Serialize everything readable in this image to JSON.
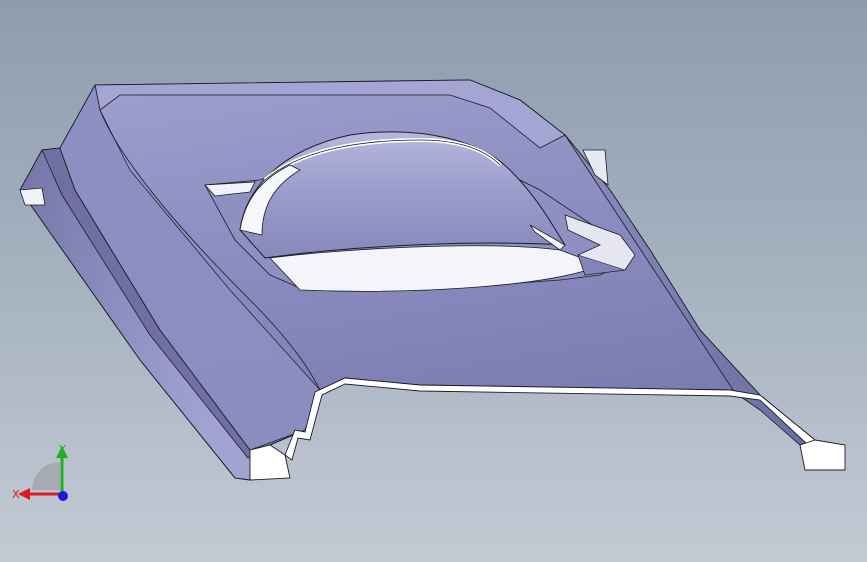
{
  "viewport": {
    "background_top": "#8e9cae",
    "background_bottom": "#c3cad4"
  },
  "model": {
    "face_color": "#8a8bc0",
    "edge_color": "#1d1d2a",
    "highlight_color": "#ffffff"
  },
  "triad": {
    "x_label": "X",
    "y_label": "Y",
    "x_color": "#e0191b",
    "y_color": "#1db21d",
    "z_color": "#1a1adb"
  }
}
